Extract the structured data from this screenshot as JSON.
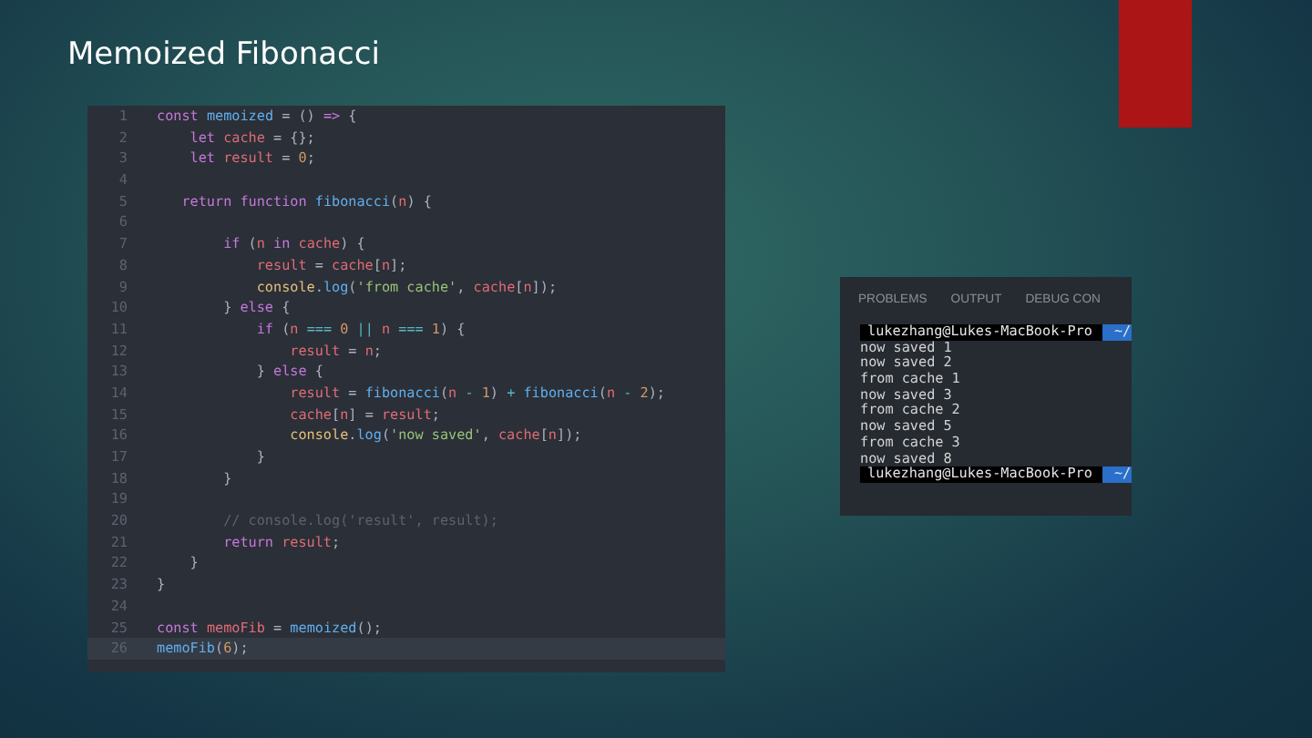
{
  "slide": {
    "title": "Memoized Fibonacci"
  },
  "editor": {
    "lines": [
      {
        "number": "1",
        "selected": false,
        "tokens": [
          {
            "kind": "keyword",
            "text": "const "
          },
          {
            "kind": "function",
            "text": "memoized"
          },
          {
            "kind": "plain",
            "text": " = () "
          },
          {
            "kind": "keyword",
            "text": "=>"
          },
          {
            "kind": "plain",
            "text": " {"
          }
        ]
      },
      {
        "number": "2",
        "selected": false,
        "tokens": [
          {
            "kind": "keyword",
            "text": "    let "
          },
          {
            "kind": "variable",
            "text": "cache"
          },
          {
            "kind": "plain",
            "text": " = {};"
          }
        ]
      },
      {
        "number": "3",
        "selected": false,
        "tokens": [
          {
            "kind": "keyword",
            "text": "    let "
          },
          {
            "kind": "variable",
            "text": "result"
          },
          {
            "kind": "plain",
            "text": " = "
          },
          {
            "kind": "number",
            "text": "0"
          },
          {
            "kind": "plain",
            "text": ";"
          }
        ]
      },
      {
        "number": "4",
        "selected": false
      },
      {
        "number": "5",
        "selected": false,
        "tokens": [
          {
            "kind": "keyword",
            "text": "   return function "
          },
          {
            "kind": "function",
            "text": "fibonacci"
          },
          {
            "kind": "plain",
            "text": "("
          },
          {
            "kind": "variable",
            "text": "n"
          },
          {
            "kind": "plain",
            "text": ") {"
          }
        ]
      },
      {
        "number": "6",
        "selected": false
      },
      {
        "number": "7",
        "selected": false,
        "tokens": [
          {
            "kind": "keyword",
            "text": "        if "
          },
          {
            "kind": "plain",
            "text": "("
          },
          {
            "kind": "variable",
            "text": "n "
          },
          {
            "kind": "keyword",
            "text": "in "
          },
          {
            "kind": "variable",
            "text": "cache"
          },
          {
            "kind": "plain",
            "text": ") {"
          }
        ]
      },
      {
        "number": "8",
        "selected": false,
        "tokens": [
          {
            "kind": "variable",
            "text": "            result"
          },
          {
            "kind": "plain",
            "text": " = "
          },
          {
            "kind": "variable",
            "text": "cache"
          },
          {
            "kind": "plain",
            "text": "["
          },
          {
            "kind": "variable",
            "text": "n"
          },
          {
            "kind": "plain",
            "text": "];"
          }
        ]
      },
      {
        "number": "9",
        "selected": false,
        "tokens": [
          {
            "kind": "object",
            "text": "            console"
          },
          {
            "kind": "plain",
            "text": "."
          },
          {
            "kind": "function",
            "text": "log"
          },
          {
            "kind": "plain",
            "text": "("
          },
          {
            "kind": "string",
            "text": "'from cache'"
          },
          {
            "kind": "plain",
            "text": ", "
          },
          {
            "kind": "variable",
            "text": "cache"
          },
          {
            "kind": "plain",
            "text": "["
          },
          {
            "kind": "variable",
            "text": "n"
          },
          {
            "kind": "plain",
            "text": "]);"
          }
        ]
      },
      {
        "number": "10",
        "selected": false,
        "tokens": [
          {
            "kind": "plain",
            "text": "        } "
          },
          {
            "kind": "keyword",
            "text": "else"
          },
          {
            "kind": "plain",
            "text": " {"
          }
        ]
      },
      {
        "number": "11",
        "selected": false,
        "tokens": [
          {
            "kind": "keyword",
            "text": "            if "
          },
          {
            "kind": "plain",
            "text": "("
          },
          {
            "kind": "variable",
            "text": "n "
          },
          {
            "kind": "operator",
            "text": "==="
          },
          {
            "kind": "number",
            "text": " 0 "
          },
          {
            "kind": "operator",
            "text": "||"
          },
          {
            "kind": "variable",
            "text": " n "
          },
          {
            "kind": "operator",
            "text": "==="
          },
          {
            "kind": "number",
            "text": " 1"
          },
          {
            "kind": "plain",
            "text": ") {"
          }
        ]
      },
      {
        "number": "12",
        "selected": false,
        "tokens": [
          {
            "kind": "variable",
            "text": "                result"
          },
          {
            "kind": "plain",
            "text": " = "
          },
          {
            "kind": "variable",
            "text": "n"
          },
          {
            "kind": "plain",
            "text": ";"
          }
        ]
      },
      {
        "number": "13",
        "selected": false,
        "tokens": [
          {
            "kind": "plain",
            "text": "            } "
          },
          {
            "kind": "keyword",
            "text": "else"
          },
          {
            "kind": "plain",
            "text": " {"
          }
        ]
      },
      {
        "number": "14",
        "selected": false,
        "tokens": [
          {
            "kind": "variable",
            "text": "                result"
          },
          {
            "kind": "plain",
            "text": " = "
          },
          {
            "kind": "function",
            "text": "fibonacci"
          },
          {
            "kind": "plain",
            "text": "("
          },
          {
            "kind": "variable",
            "text": "n"
          },
          {
            "kind": "operator",
            "text": " - "
          },
          {
            "kind": "number",
            "text": "1"
          },
          {
            "kind": "plain",
            "text": ") "
          },
          {
            "kind": "operator",
            "text": "+"
          },
          {
            "kind": "function",
            "text": " fibonacci"
          },
          {
            "kind": "plain",
            "text": "("
          },
          {
            "kind": "variable",
            "text": "n"
          },
          {
            "kind": "operator",
            "text": " - "
          },
          {
            "kind": "number",
            "text": "2"
          },
          {
            "kind": "plain",
            "text": ");"
          }
        ]
      },
      {
        "number": "15",
        "selected": false,
        "tokens": [
          {
            "kind": "variable",
            "text": "                cache"
          },
          {
            "kind": "plain",
            "text": "["
          },
          {
            "kind": "variable",
            "text": "n"
          },
          {
            "kind": "plain",
            "text": "] = "
          },
          {
            "kind": "variable",
            "text": "result"
          },
          {
            "kind": "plain",
            "text": ";"
          }
        ]
      },
      {
        "number": "16",
        "selected": false,
        "tokens": [
          {
            "kind": "object",
            "text": "                console"
          },
          {
            "kind": "plain",
            "text": "."
          },
          {
            "kind": "function",
            "text": "log"
          },
          {
            "kind": "plain",
            "text": "("
          },
          {
            "kind": "string",
            "text": "'now saved'"
          },
          {
            "kind": "plain",
            "text": ", "
          },
          {
            "kind": "variable",
            "text": "cache"
          },
          {
            "kind": "plain",
            "text": "["
          },
          {
            "kind": "variable",
            "text": "n"
          },
          {
            "kind": "plain",
            "text": "]);"
          }
        ]
      },
      {
        "number": "17",
        "selected": false,
        "tokens": [
          {
            "kind": "plain",
            "text": "            }"
          }
        ]
      },
      {
        "number": "18",
        "selected": false,
        "tokens": [
          {
            "kind": "plain",
            "text": "        }"
          }
        ]
      },
      {
        "number": "19",
        "selected": false
      },
      {
        "number": "20",
        "selected": false,
        "tokens": [
          {
            "kind": "comment",
            "text": "        // console.log('result', result);"
          }
        ]
      },
      {
        "number": "21",
        "selected": false,
        "tokens": [
          {
            "kind": "keyword",
            "text": "        return "
          },
          {
            "kind": "variable",
            "text": "result"
          },
          {
            "kind": "plain",
            "text": ";"
          }
        ]
      },
      {
        "number": "22",
        "selected": false,
        "tokens": [
          {
            "kind": "plain",
            "text": "    }"
          }
        ]
      },
      {
        "number": "23",
        "selected": false,
        "tokens": [
          {
            "kind": "plain",
            "text": "}"
          }
        ]
      },
      {
        "number": "24",
        "selected": false
      },
      {
        "number": "25",
        "selected": false,
        "tokens": [
          {
            "kind": "keyword",
            "text": "const "
          },
          {
            "kind": "variable",
            "text": "memoFib"
          },
          {
            "kind": "plain",
            "text": " = "
          },
          {
            "kind": "function",
            "text": "memoized"
          },
          {
            "kind": "plain",
            "text": "();"
          }
        ]
      },
      {
        "number": "26",
        "selected": true,
        "tokens": [
          {
            "kind": "function",
            "text": "memoFib"
          },
          {
            "kind": "plain",
            "text": "("
          },
          {
            "kind": "number",
            "text": "6"
          },
          {
            "kind": "plain",
            "text": ");"
          }
        ]
      }
    ]
  },
  "terminal": {
    "tabs": [
      "PROBLEMS",
      "OUTPUT",
      "DEBUG CON"
    ],
    "lines": [
      {
        "kind": "prompt",
        "text": "lukezhang@Lukes-MacBook-Pro",
        "path": "~/"
      },
      {
        "kind": "output",
        "text": "now saved 1"
      },
      {
        "kind": "output",
        "text": "now saved 2"
      },
      {
        "kind": "output",
        "text": "from cache 1"
      },
      {
        "kind": "output",
        "text": "now saved 3"
      },
      {
        "kind": "output",
        "text": "from cache 2"
      },
      {
        "kind": "output",
        "text": "now saved 5"
      },
      {
        "kind": "output",
        "text": "from cache 3"
      },
      {
        "kind": "output",
        "text": "now saved 8"
      },
      {
        "kind": "prompt",
        "text": "lukezhang@Lukes-MacBook-Pro",
        "path": "~/"
      }
    ]
  }
}
